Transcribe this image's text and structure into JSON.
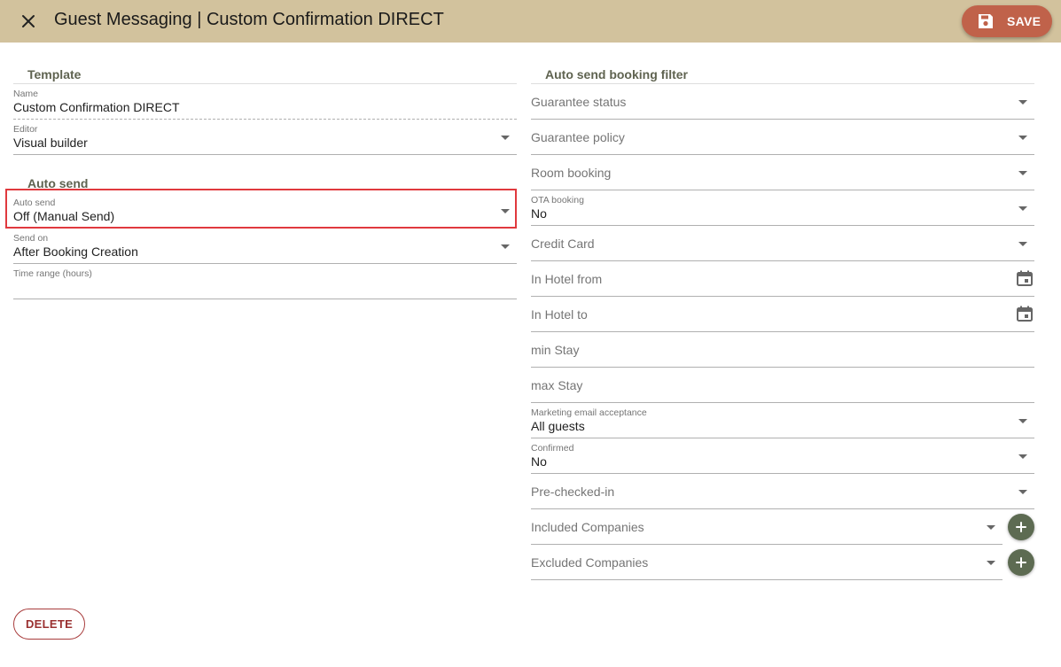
{
  "header": {
    "title": "Guest Messaging | Custom Confirmation DIRECT",
    "save_label": "SAVE"
  },
  "colors": {
    "topbar": "#d2c29d",
    "save_button": "#c0624a",
    "add_button": "#5d6b52",
    "highlight": "#e0393e",
    "delete_text": "#9a3030"
  },
  "template_section": {
    "title": "Template",
    "name": {
      "label": "Name",
      "value": "Custom Confirmation DIRECT"
    },
    "editor": {
      "label": "Editor",
      "value": "Visual builder"
    }
  },
  "auto_send_section": {
    "title": "Auto send",
    "auto_send": {
      "label": "Auto send",
      "value": "Off (Manual Send)"
    },
    "send_on": {
      "label": "Send on",
      "value": "After Booking Creation"
    },
    "time_range": {
      "label": "Time range (hours)",
      "value": ""
    }
  },
  "filter_section": {
    "title": "Auto send booking filter",
    "guarantee_status": {
      "placeholder": "Guarantee status"
    },
    "guarantee_policy": {
      "placeholder": "Guarantee policy"
    },
    "room_booking": {
      "placeholder": "Room booking"
    },
    "ota_booking": {
      "label": "OTA booking",
      "value": "No"
    },
    "credit_card": {
      "placeholder": "Credit Card"
    },
    "in_hotel_from": {
      "placeholder": "In Hotel from"
    },
    "in_hotel_to": {
      "placeholder": "In Hotel to"
    },
    "min_stay": {
      "placeholder": "min Stay"
    },
    "max_stay": {
      "placeholder": "max Stay"
    },
    "marketing_email": {
      "label": "Marketing email acceptance",
      "value": "All guests"
    },
    "confirmed": {
      "label": "Confirmed",
      "value": "No"
    },
    "pre_checked_in": {
      "placeholder": "Pre-checked-in"
    },
    "included_companies": {
      "placeholder": "Included Companies"
    },
    "excluded_companies": {
      "placeholder": "Excluded Companies"
    }
  },
  "footer": {
    "delete_label": "DELETE"
  },
  "icons": {
    "close": "close-icon",
    "save": "floppy-disk-icon",
    "dropdown": "dropdown-arrow-icon",
    "calendar": "calendar-icon",
    "add": "plus-icon"
  }
}
